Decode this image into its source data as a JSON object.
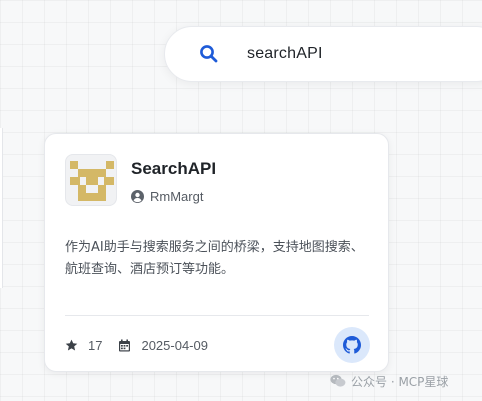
{
  "search": {
    "icon": "search-icon",
    "query": "searchAPI"
  },
  "card": {
    "logo_icon": "searchapi-logo",
    "logo_color": "#d4b866",
    "title": "SearchAPI",
    "author_icon": "user-circle-icon",
    "author": "RmMargt",
    "description": "作为AI助手与搜索服务之间的桥梁，支持地图搜索、航班查询、酒店预订等功能。",
    "stars_icon": "star-icon",
    "stars": "17",
    "date_icon": "calendar-icon",
    "date": "2025-04-09",
    "github_icon": "github-icon",
    "accent": "#1e5bd8"
  },
  "watermark": {
    "icon": "wechat-icon",
    "text": "公众号 · MCP星球"
  }
}
